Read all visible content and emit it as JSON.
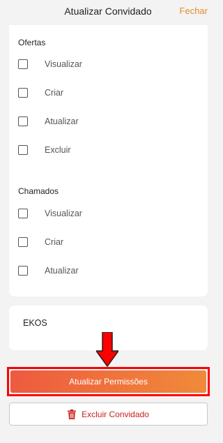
{
  "header": {
    "title": "Atualizar Convidado",
    "close_label": "Fechar"
  },
  "sections": [
    {
      "title": "Ofertas",
      "items": [
        "Visualizar",
        "Criar",
        "Atualizar",
        "Excluir"
      ]
    },
    {
      "title": "Chamados",
      "items": [
        "Visualizar",
        "Criar",
        "Atualizar"
      ]
    }
  ],
  "ekos": {
    "label": "EKOS"
  },
  "actions": {
    "update_label": "Atualizar Permissões",
    "delete_label": "Excluir Convidado"
  },
  "colors": {
    "accent_orange": "#e58b2e",
    "danger_red": "#c7211d",
    "annotation_red": "#ff0000"
  },
  "icons": {
    "delete": "trash-icon",
    "annotation": "down-arrow-icon"
  }
}
